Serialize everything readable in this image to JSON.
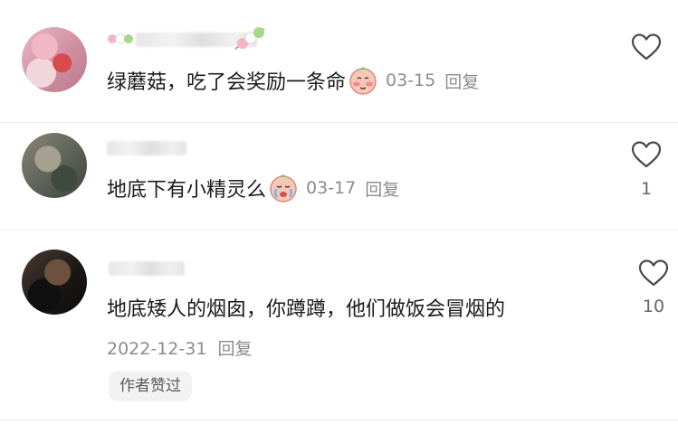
{
  "comments": [
    {
      "text": "绿蘑菇，吃了会奖励一条命",
      "emoji": "blushing-face-emoji",
      "date": "03-15",
      "reply_label": "回复",
      "like_count": ""
    },
    {
      "text": "地底下有小精灵么",
      "emoji": "crying-face-emoji",
      "date": "03-17",
      "reply_label": "回复",
      "like_count": "1"
    },
    {
      "text": "地底矮人的烟囱，你蹲蹲，他们做饭会冒烟的",
      "date": "2022-12-31",
      "reply_label": "回复",
      "like_count": "10",
      "badge": "作者赞过"
    }
  ],
  "icons": {
    "like": "heart-outline-icon"
  },
  "colors": {
    "text_primary": "#1b1b1b",
    "text_secondary": "#8c8c8c",
    "divider": "#ececec",
    "badge_bg": "#f2f2f2"
  }
}
